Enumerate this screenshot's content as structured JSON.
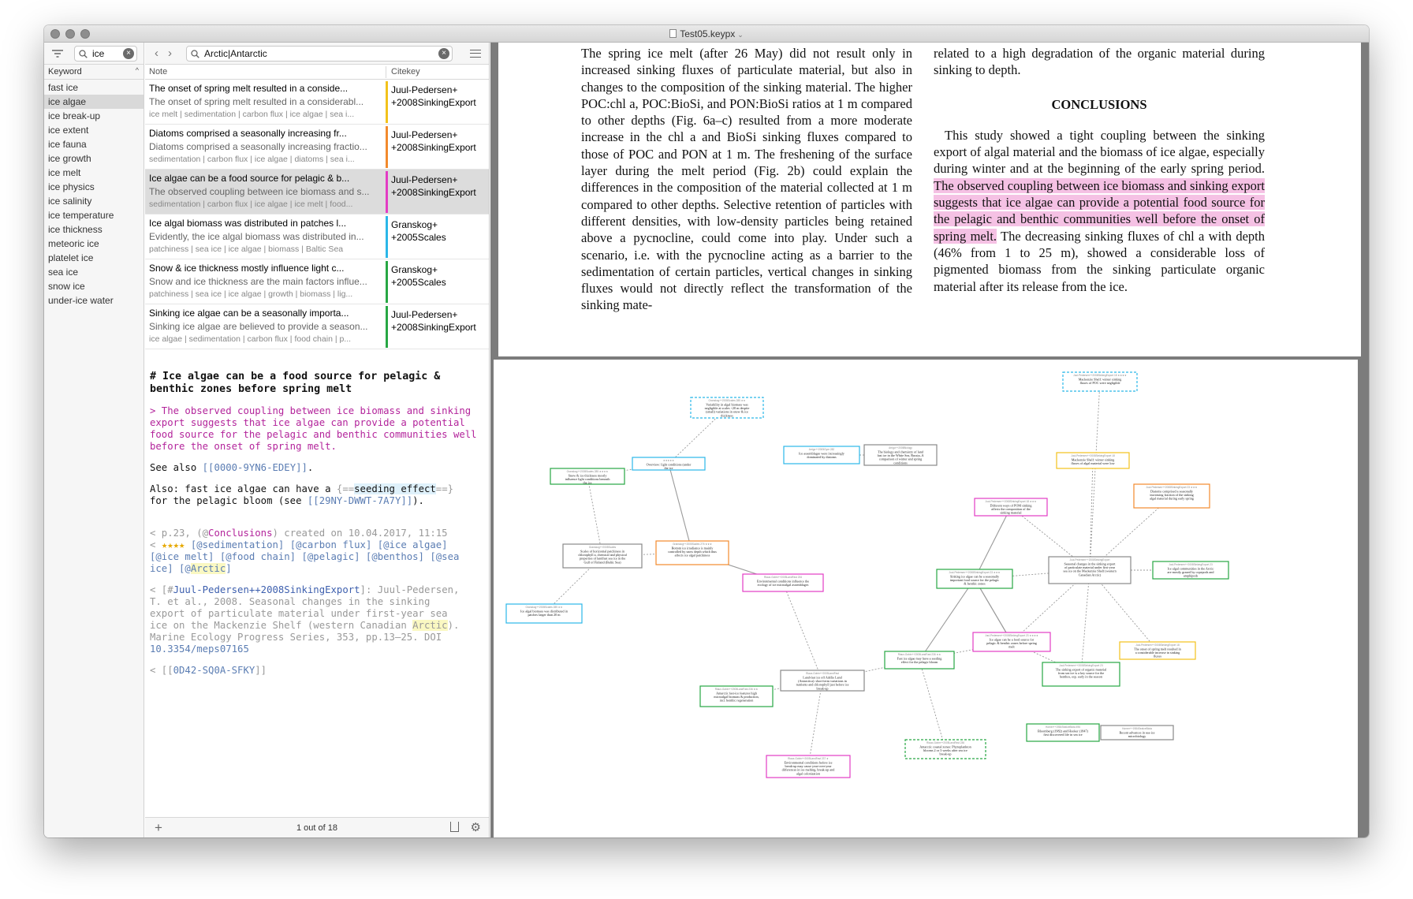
{
  "window": {
    "title": "Test05.keypx"
  },
  "keywords": {
    "search_value": "ice",
    "header": "Keyword",
    "items": [
      "fast ice",
      "ice algae",
      "ice break-up",
      "ice extent",
      "ice fauna",
      "ice growth",
      "ice melt",
      "ice physics",
      "ice salinity",
      "ice temperature",
      "ice thickness",
      "meteoric ice",
      "platelet ice",
      "sea ice",
      "snow ice",
      "under-ice water"
    ],
    "selected": "ice algae"
  },
  "notes": {
    "search_value": "Arctic|Antarctic",
    "col_note": "Note",
    "col_citekey": "Citekey",
    "rows": [
      {
        "title": "The onset of spring melt resulted in a conside...",
        "summary": "The onset of spring melt resulted in a considerabl...",
        "keywords": "ice melt | sedimentation | carbon flux | ice algae | sea i...",
        "citekey1": "Juul-Pedersen+",
        "citekey2": "+2008SinkingExport",
        "color": "#f2c21b"
      },
      {
        "title": "Diatoms comprised a seasonally increasing fr...",
        "summary": "Diatoms comprised a seasonally increasing fractio...",
        "keywords": "sedimentation | carbon flux | ice algae | diatoms | sea i...",
        "citekey1": "Juul-Pedersen+",
        "citekey2": "+2008SinkingExport",
        "color": "#f28a2d"
      },
      {
        "title": "Ice algae can be a food source for pelagic & b...",
        "summary": "The observed coupling between ice biomass and s...",
        "keywords": "sedimentation | carbon flux | ice algae | ice melt | food...",
        "citekey1": "Juul-Pedersen+",
        "citekey2": "+2008SinkingExport",
        "color": "#e33dc4"
      },
      {
        "title": "Ice algal biomass was distributed in patches l...",
        "summary": "Evidently, the ice algal biomass was distributed in...",
        "keywords": "patchiness | sea ice | ice algae | biomass | Baltic Sea",
        "citekey1": "Granskog+",
        "citekey2": "+2005Scales",
        "color": "#2bb7e8"
      },
      {
        "title": "Snow & ice thickness mostly influence light c...",
        "summary": "Snow and ice thickness are the main factors influe...",
        "keywords": "patchiness | sea ice | ice algae | growth | biomass | lig...",
        "citekey1": "Granskog+",
        "citekey2": "+2005Scales",
        "color": "#27a744"
      },
      {
        "title": "Sinking ice algae can be a seasonally importa...",
        "summary": "Sinking ice algae are believed to provide a season...",
        "keywords": "ice algae | sedimentation | carbon flux | food chain | p...",
        "citekey1": "Juul-Pedersen+",
        "citekey2": "+2008SinkingExport",
        "color": "#27a744"
      }
    ],
    "selected_index": 2,
    "status": "1 out of 18"
  },
  "editor": {
    "heading": "# Ice algae can be a food source for pelagic & benthic zones before spring melt",
    "quote": "> The observed coupling between ice biomass and sinking export suggests that ice algae can provide a potential food source for the pelagic and benthic communities well before the onset of spring melt.",
    "see_also_prefix": "See also ",
    "see_also_link": "[[0000-9YN6-EDEY]]",
    "see_also_suffix": ".",
    "also_prefix": "Also: fast ice algae can have a ",
    "also_mark_open": "{==",
    "also_mark": "seeding effect",
    "also_mark_close": "==}",
    "also_mid": "\nfor the pelagic bloom (see ",
    "also_link": "[[29NY-DWWT-7A7Y]]",
    "also_suffix": ").",
    "meta1_a": "< p.23, (@",
    "meta1_b": "Conclusions",
    "meta1_c": ") created on 10.04.2017, 11:15",
    "meta2_a": "< ",
    "meta2_stars": "★★★★",
    "meta2_tags1": " [@sedimentation] [@carbon flux] [@ice algae]\n[@ice melt] [@food chain] [@pelagic] [@benthos] [@sea\nice] [@",
    "meta2_arctic": "Arctic",
    "meta2_end": "]",
    "ref_a": "< [#",
    "ref_key": "Juul-Pedersen++2008SinkingExport",
    "ref_b": "]: Juul-Pedersen,\nT. et al., 2008. Seasonal changes in the sinking\nexport of particulate material under first-year sea\nice on the Mackenzie Shelf (western Canadian ",
    "ref_arctic": "Arctic",
    "ref_c": ").\nMarine Ecology Progress Series, 353, pp.13–25. DOI\n",
    "ref_doi": "10.3354/meps07165",
    "last_a": "< [[",
    "last_link": "0D42-SQ0A-SFKY",
    "last_b": "]]"
  },
  "pdf": {
    "col1": "The spring ice melt (after 26 May) did not result only in increased sinking fluxes of particulate material, but also in changes to the composition of the sinking material. The higher POC:chl a, POC:BioSi, and PON:BioSi ratios at 1 m compared to other depths (Fig. 6a–c) resulted from a more moderate increase in the chl a and BioSi sinking fluxes compared to those of POC and PON at 1 m. The freshening of the surface layer during the melt period (Fig. 2b) could explain the differences in the composition of the material collected at 1 m compared to other depths. Selective retention of particles with different densities, with low-density particles being retained above a pycnocline, could come into play. Under such a scenario, i.e. with the pycnocline acting as a barrier to the sedimentation of certain particles, vertical changes in sinking fluxes would not directly reflect the transformation of the sinking mate-",
    "col2_top": "related to a high degradation of the organic material during sinking to depth.",
    "conclusions_heading": "CONCLUSIONS",
    "col2_p1": "This study showed a tight coupling between the sinking export of algal material and the biomass of ice algae, especially during winter and at the beginning of the early spring period. ",
    "col2_hl": "The observed coupling between ice biomass and sinking export suggests that ice algae can provide a potential food source for the pelagic and benthic communities well before the onset of spring melt.",
    "col2_p2": " The decreasing sinking fluxes of chl a with depth (46% from 1 to 25 m), showed a considerable loss of pigmented biomass from the sinking particulate organic material after its release from the ice."
  },
  "graph_nodes": [
    {
      "id": "n1",
      "head": "Granskog++2005Scales 285 ★★",
      "text": "Variability in algal biomass was negligible at scales <20 m despite (small) variations in snow & ice thickness",
      "color": "#2bb7e8",
      "dashed": true
    },
    {
      "id": "n2",
      "head": "★★★★★",
      "text": "Overview: light conditions (under the ice",
      "color": "#2bb7e8",
      "dashed": false
    },
    {
      "id": "n3",
      "head": "Granskog++2005Scales 285 ★★★★",
      "text": "Snow & ice thickness mostly influence light conditions beneath the ice",
      "color": "#27a744",
      "dashed": false
    },
    {
      "id": "n4",
      "head": "Arrigo++2005Gyre 282",
      "text": "Ice assemblages were increasingly dominated by diatoms",
      "color": "#2bb7e8",
      "dashed": false
    },
    {
      "id": "n5",
      "head": "Arrigo++2005Biology",
      "text": "The biology and chemistry of land fast ice in the White Sea, Russia–A comparison of winter and spring conditions",
      "color": "#888888",
      "dashed": false
    },
    {
      "id": "n6",
      "head": "Juul-Pedersen++2008SinkingExport 18 ★★★★",
      "text": "Mackenzie Shelf: winter sinking fluxes of POC were negligible",
      "color": "#2bb7e8",
      "dashed": true
    },
    {
      "id": "n7",
      "head": "Juul-Pedersen++2008SinkingExport 18",
      "text": "Mackenzie Shelf: winter sinking fluxes of algal material were low",
      "color": "#f2c21b",
      "dashed": false
    },
    {
      "id": "n8",
      "head": "Juul-Pedersen++2008SinkingExport 23 ★★★",
      "text": "Diatoms comprised a seasonally increasing fraction of the sinking algal material during early spring",
      "color": "#f28a2d",
      "dashed": false
    },
    {
      "id": "n9",
      "head": "Juul-Pedersen++2008SinkingExport 18 ★★★",
      "text": "Different ways of POM sinking affects the composition of the sinking material",
      "color": "#e33dc4",
      "dashed": false
    },
    {
      "id": "n10",
      "head": "Granskog++2005Scales",
      "text": "Scales of horizontal patchiness in chlorophyll a, chemical and physical properties of landfast sea ice in the Gulf of Finland (Baltic Sea)",
      "color": "#888888",
      "dashed": false
    },
    {
      "id": "n11",
      "head": "Granskog++2005Scales 276 ★★★",
      "text": "Bottom ice irradiance is mainly controlled by snow depth which thus affects ice algal patchiness",
      "color": "#f28a2d",
      "dashed": false
    },
    {
      "id": "n12",
      "head": "Riaux-Gobin++2005LandFast 234",
      "text": "Environmental conditions influence the ecology of ice microalgal assemblages",
      "color": "#e33dc4",
      "dashed": false
    },
    {
      "id": "n13",
      "head": "Juul-Pedersen++2008SinkingExport",
      "text": "Seasonal changes in the sinking export of particulate material under first-year sea ice on the Mackenzie Shelf (western Canadian Arctic)",
      "color": "#888888",
      "dashed": false
    },
    {
      "id": "n14",
      "head": "Juul-Pedersen++2008SinkingExport 23 ★★★",
      "text": "Sinking ice algae can be a seasonally important food source for the pelagic & benthic zones",
      "color": "#27a744",
      "dashed": false
    },
    {
      "id": "n15",
      "head": "Juul-Pedersen++2008SinkingExport 23",
      "text": "Ice algal communities in the Arctic are mostly grazed by copepods and amphipods",
      "color": "#27a744",
      "dashed": false
    },
    {
      "id": "n16",
      "head": "Granskog++2005Scales 285 ★★",
      "text": "Ice algal biomass was distributed in patches larger than 20 m",
      "color": "#2bb7e8",
      "dashed": false
    },
    {
      "id": "n17",
      "head": "Juul-Pedersen++2008SinkingExport 23 ★★★★",
      "text": "Ice algae can be a food source for pelagic & benthic zones before spring melt",
      "color": "#e33dc4",
      "dashed": false
    },
    {
      "id": "n18",
      "head": "Juul-Pedersen++2008SinkingExport 18",
      "text": "The onset of spring melt resulted in a considerable increase in sinking fluxes",
      "color": "#f2c21b",
      "dashed": false
    },
    {
      "id": "n19",
      "head": "Riaux-Gobin++2005LandFast 236 ★★",
      "text": "Fast ice algae may have a seeding effect for the pelagic bloom",
      "color": "#27a744",
      "dashed": false
    },
    {
      "id": "n20",
      "head": "Riaux-Gobin++2005LandFast",
      "text": "Land-fast ice off Adélie Land (Antarctica): short-term variations in nutrients and chlorophyll just before ice break-up",
      "color": "#888888",
      "dashed": false
    },
    {
      "id": "n21",
      "head": "Juul-Pedersen++2008SinkingExport 23",
      "text": "The sinking export of organic material from sea ice is a key source for the benthos, esp. early in the season",
      "color": "#27a744",
      "dashed": false
    },
    {
      "id": "n22",
      "head": "Riaux-Gobin++2005LandFast 236 ★★",
      "text": "Antarctic fast-ice features high microalgal biomass & production, incl. benthic regeneration",
      "color": "#27a744",
      "dashed": false
    },
    {
      "id": "n23",
      "head": "Riaux-Gobin++2005LandFast 236",
      "text": "Antarctic coastal zones: Phytoplankton blooms 2 or 3 weeks after sea ice break-up",
      "color": "#27a744",
      "dashed": true
    },
    {
      "id": "n24",
      "head": "Horner++1984SeaIceBiota 496",
      "text": "Bloomberg (1982) and Hooker (1847) first discovered life in sea ice",
      "color": "#27a744",
      "dashed": false
    },
    {
      "id": "n25",
      "head": "Horner++1984SeaIceBiota",
      "text": "Recent advances in sea-ice microbiology",
      "color": "#888888",
      "dashed": false
    },
    {
      "id": "n26",
      "head": "Riaux-Gobin++2005LandFast 237 ★",
      "text": "Environmental conditions before ice break-up may cause year-over-year differences in ice melting, break-up and algal colonization",
      "color": "#e33dc4",
      "dashed": false
    }
  ]
}
